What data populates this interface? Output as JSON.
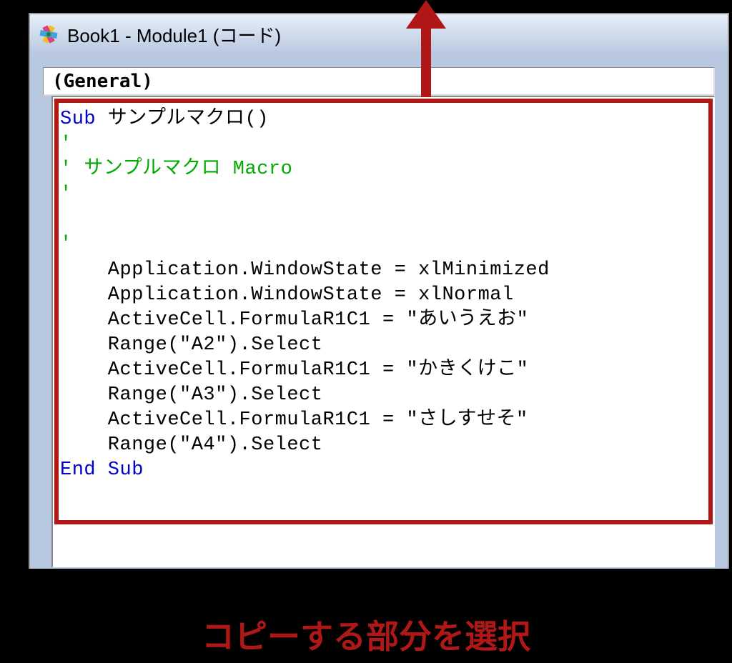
{
  "window": {
    "title": "Book1 - Module1 (コード)"
  },
  "dropdown": {
    "object_selector": "(General)"
  },
  "code": {
    "line1_kw": "Sub",
    "line1_rest": " サンプルマクロ()",
    "line2": "'",
    "line3": "' サンプルマクロ Macro",
    "line4": "'",
    "line5": "",
    "line6": "'",
    "line7": "    Application.WindowState = xlMinimized",
    "line8": "    Application.WindowState = xlNormal",
    "line9": "    ActiveCell.FormulaR1C1 = \"あいうえお\"",
    "line10": "    Range(\"A2\").Select",
    "line11": "    ActiveCell.FormulaR1C1 = \"かきくけこ\"",
    "line12": "    Range(\"A3\").Select",
    "line13": "    ActiveCell.FormulaR1C1 = \"さしすせそ\"",
    "line14": "    Range(\"A4\").Select",
    "line15": "End Sub"
  },
  "annotation": {
    "caption": "コピーする部分を選択"
  }
}
